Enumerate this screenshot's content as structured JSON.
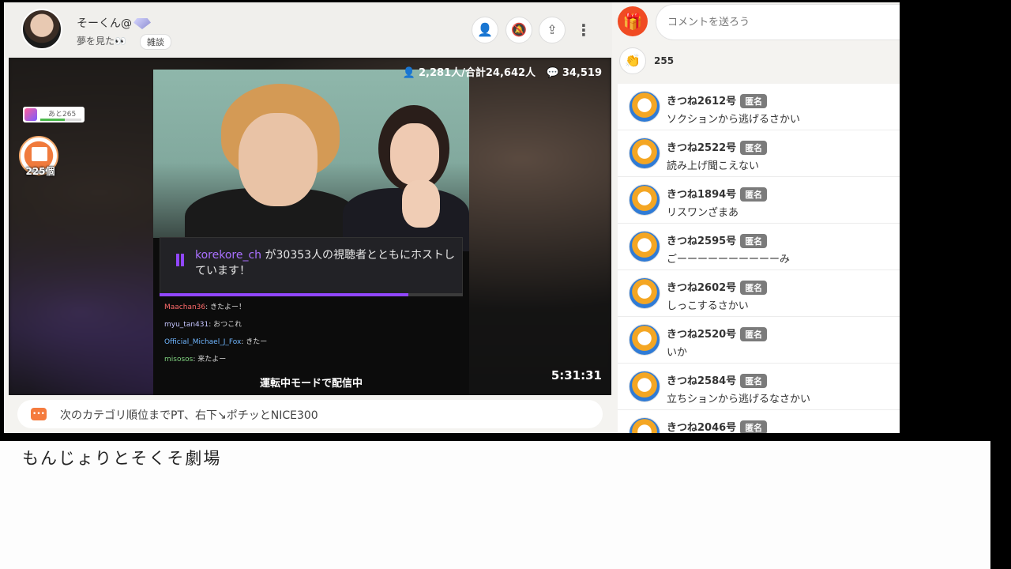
{
  "header": {
    "host_name": "そーくん@",
    "subtitle": "夢を見た👀",
    "category": "雑談",
    "buttons": [
      "follow-icon",
      "mute-icon",
      "share-icon",
      "more-icon"
    ]
  },
  "player": {
    "viewers": "2,281人/合計24,642人",
    "comments_count": "34,519",
    "gauge_label": "あと265",
    "gauge_level": 0.6,
    "gift_count": "225個",
    "timer": "5:31:31",
    "host_channel": "korekore_ch",
    "host_message": "が30353人の視聴者とともにホストしています！",
    "host_progress": 0.82,
    "driving_text": "運転中モードで配信中",
    "chat": [
      {
        "user": "Maachan36",
        "text": "きたよー！"
      },
      {
        "user": "myu_tan431",
        "text": "おつこれ"
      },
      {
        "user": "Official_Michael_J_Fox",
        "text": "きたー"
      },
      {
        "user": "misosos",
        "text": "来たよー"
      }
    ]
  },
  "telop": {
    "text": "次のカテゴリ順位までPT、右下↘ポチッとNICE300"
  },
  "comment_panel": {
    "placeholder": "コメントを送ろう",
    "clap_count": "255",
    "anon_label": "匿名",
    "items": [
      {
        "name": "きつね2612号",
        "text": "ソクションから逃げるさかい"
      },
      {
        "name": "きつね2522号",
        "text": "読み上げ聞こえない"
      },
      {
        "name": "きつね1894号",
        "text": "リスワンざまあ"
      },
      {
        "name": "きつね2595号",
        "text": "ごーーーーーーーーーーみ"
      },
      {
        "name": "きつね2602号",
        "text": "しっこするさかい"
      },
      {
        "name": "きつね2520号",
        "text": "いか"
      },
      {
        "name": "きつね2584号",
        "text": "立ちションから逃げるなさかい"
      },
      {
        "name": "きつね2046号",
        "text": ""
      }
    ]
  },
  "below": {
    "caption": "もんじょりとそくそ劇場"
  },
  "colors": {
    "accent": "#f04b23",
    "twitch_purple": "#9147ff"
  }
}
